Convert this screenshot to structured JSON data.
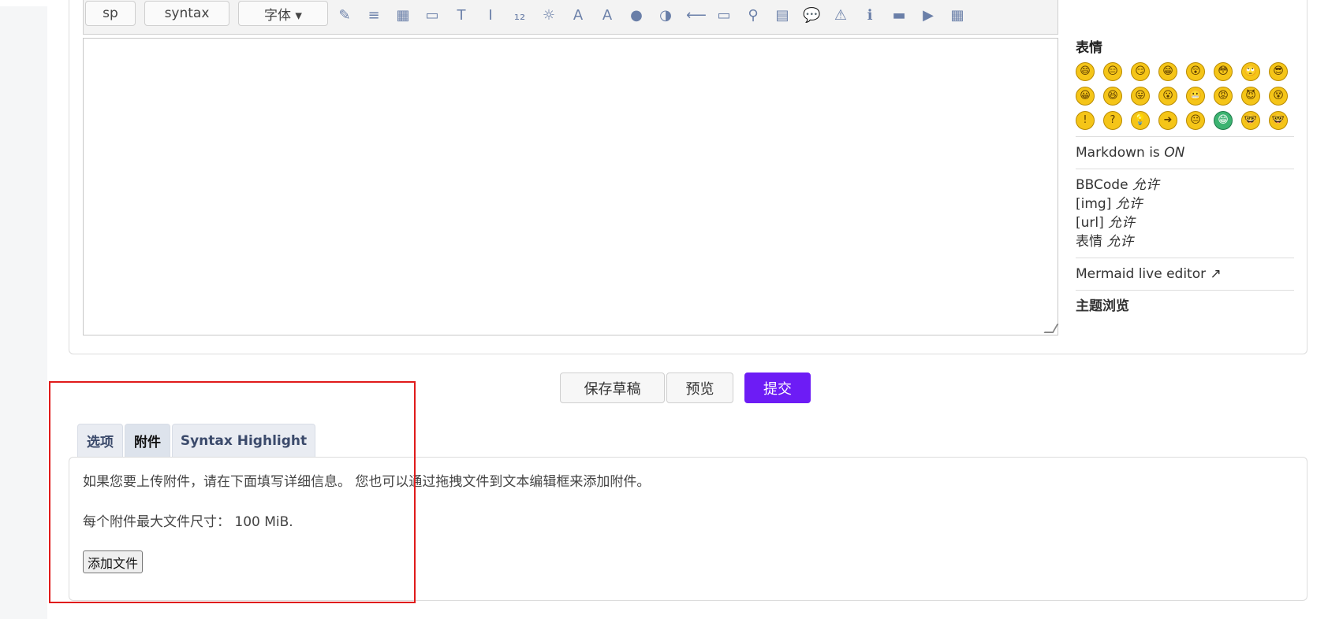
{
  "toolbar": {
    "buttons": [
      "sp",
      "syntax",
      "字体 ▾"
    ]
  },
  "sidebar": {
    "emoji_heading": "表情",
    "emojis": [
      "😄",
      "😑",
      "😏",
      "😁",
      "😲",
      "😳",
      "🙄",
      "😎",
      "😀",
      "😆",
      "😛",
      "😮",
      "😬",
      "😡",
      "😈",
      "😵",
      "!",
      "?",
      "💡",
      "➜",
      "😐",
      "😁",
      "🤓",
      "🤓"
    ],
    "markdown_label": "Markdown is",
    "markdown_value": "ON",
    "bbcode_label": "BBCode",
    "img_label": "[img]",
    "url_label": "[url]",
    "emoji_label": "表情",
    "allowed": "允许",
    "mermaid_link": "Mermaid live editor",
    "theme_browse": "主题浏览"
  },
  "actions": {
    "save_draft": "保存草稿",
    "preview": "预览",
    "submit": "提交"
  },
  "tabs": {
    "options": "选项",
    "attachments": "附件",
    "syntax": "Syntax Highlight"
  },
  "attachments": {
    "info": "如果您要上传附件，请在下面填写详细信息。 您也可以通过拖拽文件到文本编辑框来添加附件。",
    "max_size_label": "每个附件最大文件尺寸：",
    "max_size_value": "100 MiB.",
    "add_file": "添加文件"
  },
  "colors": {
    "primary": "#6d1cf5",
    "highlight_box": "#e01b1b"
  }
}
